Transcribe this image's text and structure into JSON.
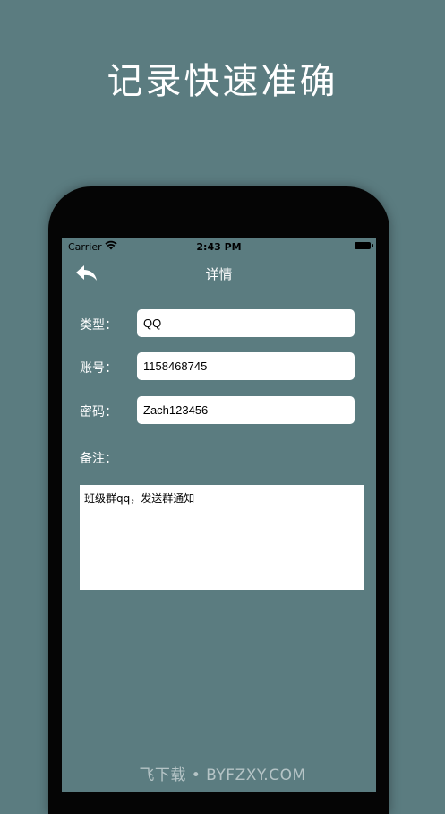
{
  "headline": "记录快速准确",
  "status_bar": {
    "carrier": "Carrier",
    "time": "2:43 PM"
  },
  "nav": {
    "title": "详情",
    "back_icon": "back-arrow-icon"
  },
  "fields": {
    "type": {
      "label": "类型：",
      "value": "QQ"
    },
    "account": {
      "label": "账号：",
      "value": "1158468745"
    },
    "password": {
      "label": "密码：",
      "value": "Zach123456"
    }
  },
  "note": {
    "label": "备注：",
    "value": "班级群qq，发送群通知"
  },
  "watermark": "飞下载 • BYFZXY.COM",
  "colors": {
    "background": "#5b7c80",
    "phone_frame": "#050505",
    "text": "#ffffff"
  }
}
